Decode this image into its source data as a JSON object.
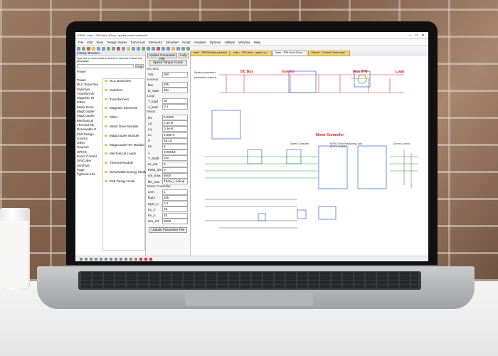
{
  "window": {
    "title": "PSIM - main - IPM drive (Flux) - speed control psimsch*"
  },
  "menubar": [
    "File",
    "Edit",
    "View",
    "Design Suites",
    "Subcircuit",
    "Elements",
    "Simulate",
    "Script",
    "Analysis",
    "Options",
    "Utilities",
    "Window",
    "Help"
  ],
  "tabs": [
    {
      "label": "main - PMSM drive.psimsch"
    },
    {
      "label": "main - IPM drive - speed co..."
    },
    {
      "label": "main - IPM drive (Flux)..."
    },
    {
      "label": "Vbrack - Current Control.psi..."
    }
  ],
  "library": {
    "header": "Library Browser",
    "hint": "Type one or more words to search in element's name and description",
    "find_label": "Find",
    "tree_root": "Power",
    "tree": [
      "Power",
      "RLC Branches",
      "Switches",
      "Transformer",
      "Magnetic El",
      "Other",
      "Motor Drive",
      "MagCoupler",
      "MagCoupler",
      "Mechanical",
      "Thermal Mo",
      "Renewable E",
      "EMI Design",
      "Control",
      "Other",
      "Sources",
      "SPICE",
      "Event Control",
      "SimCoder",
      "Symbols",
      "Page",
      "Typhoon HIL"
    ],
    "categories": [
      "RLC Branches",
      "Switches",
      "Transformers",
      "Magnetic Elements",
      "Other",
      "Motor Drive Module",
      "MagCoupler Module",
      "MagCoupler-RT Module",
      "Mechanical Loads",
      "Thermal Module",
      "Renewable Energy Module",
      "EMI Design Suite"
    ]
  },
  "params": {
    "update_btn": "Update Parameter File",
    "help_btn": "Help",
    "speed_btn": "Speed Torque Curve",
    "sections": [
      {
        "title": "DC Bus",
        "rows": [
          [
            "Vdc",
            "300"
          ]
        ]
      },
      {
        "title": "Inverter",
        "rows": [
          [
            "fsw",
            "20k"
          ],
          [
            "ts_stws",
            "40e"
          ]
        ]
      },
      {
        "title": "Load",
        "rows": [
          [
            "T_load",
            "50"
          ],
          [
            "J_load",
            "0.1"
          ]
        ]
      },
      {
        "title": "Motor",
        "rows": [
          [
            "Rs",
            "0.0203"
          ],
          [
            "Ld",
            "0.1e-8"
          ],
          [
            "Lq",
            "0.3e-8"
          ],
          [
            "Lc",
            "1.59e-4"
          ],
          [
            "P",
            "46.15"
          ],
          [
            "Ke",
            "6"
          ],
          [
            "J",
            "0.00813"
          ],
          [
            "T_shaft",
            "100"
          ],
          [
            "wr_init",
            "0"
          ],
          [
            "theta_init",
            "0"
          ],
          [
            "nm_max",
            "6000"
          ],
          [
            "file_mat",
            "Theta_Lookup"
          ]
        ]
      },
      {
        "title": "Motor Controller",
        "rows": [
          [
            "com",
            "1"
          ],
          [
            "fsam",
            "20k"
          ],
          [
            "Kpm_n",
            "0.1"
          ],
          [
            "Kc_n",
            "15"
          ],
          [
            "Kv_n",
            "25"
          ],
          [
            "wm_ref",
            "6000"
          ]
        ]
      }
    ],
    "update_btn2": "Update Parameter File"
  },
  "schematic": {
    "labels": [
      "DC Bus",
      "Inverter",
      "Flux IPM",
      "Load",
      "Motor Controller"
    ],
    "sublabels": [
      "Speed Controller",
      "MTPA, Field Weakening, and MTPV Control",
      "Current Control"
    ],
    "note1": "System parameters",
    "note2": "parameters-main.txt"
  }
}
